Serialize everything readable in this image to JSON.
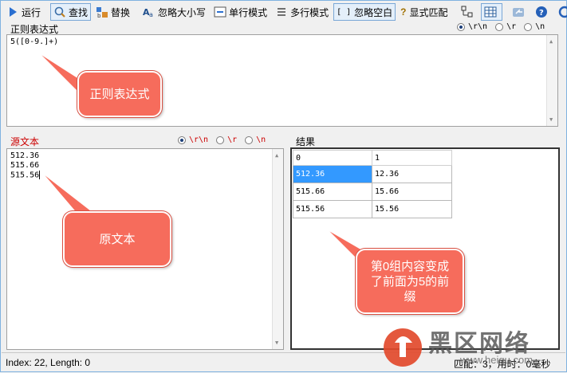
{
  "toolbar": {
    "run": "运行",
    "find": "查找",
    "replace": "替换",
    "ignore_case": "忽略大小写",
    "single_line": "单行模式",
    "multi_line": "多行模式",
    "ignore_space": "忽略空白",
    "explicit": "显式匹配",
    "explicit_prefix": "?",
    "ignore_space_prefix": "[ ]"
  },
  "regex": {
    "label": "正则表达式",
    "value": "5([0-9.]+)",
    "nl_options": [
      "\\r\\n",
      "\\r",
      "\\n"
    ],
    "nl_selected": "\\r\\n"
  },
  "source": {
    "label": "源文本",
    "lines": [
      "512.36",
      "515.66",
      "515.56"
    ],
    "nl_options": [
      "\\r\\n",
      "\\r",
      "\\n"
    ],
    "nl_selected": "\\r\\n"
  },
  "result": {
    "label": "结果",
    "columns": [
      "0",
      "1"
    ],
    "rows": [
      [
        "512.36",
        "12.36"
      ],
      [
        "515.66",
        "15.66"
      ],
      [
        "515.56",
        "15.56"
      ]
    ]
  },
  "callouts": {
    "regex": "正则表达式",
    "source": "原文本",
    "result_line1": "第0组内容变成",
    "result_line2": "了前面为5的前",
    "result_line3": "缀"
  },
  "status": {
    "left": "Index: 22, Length: 0",
    "right": "匹配：3，用时：0毫秒"
  },
  "watermark": {
    "main": "黑区网络",
    "sub": "www.heiqu.com"
  },
  "colors": {
    "accent": "#3399ff",
    "callout": "#f66c5c",
    "source_label": "#cc0000"
  }
}
